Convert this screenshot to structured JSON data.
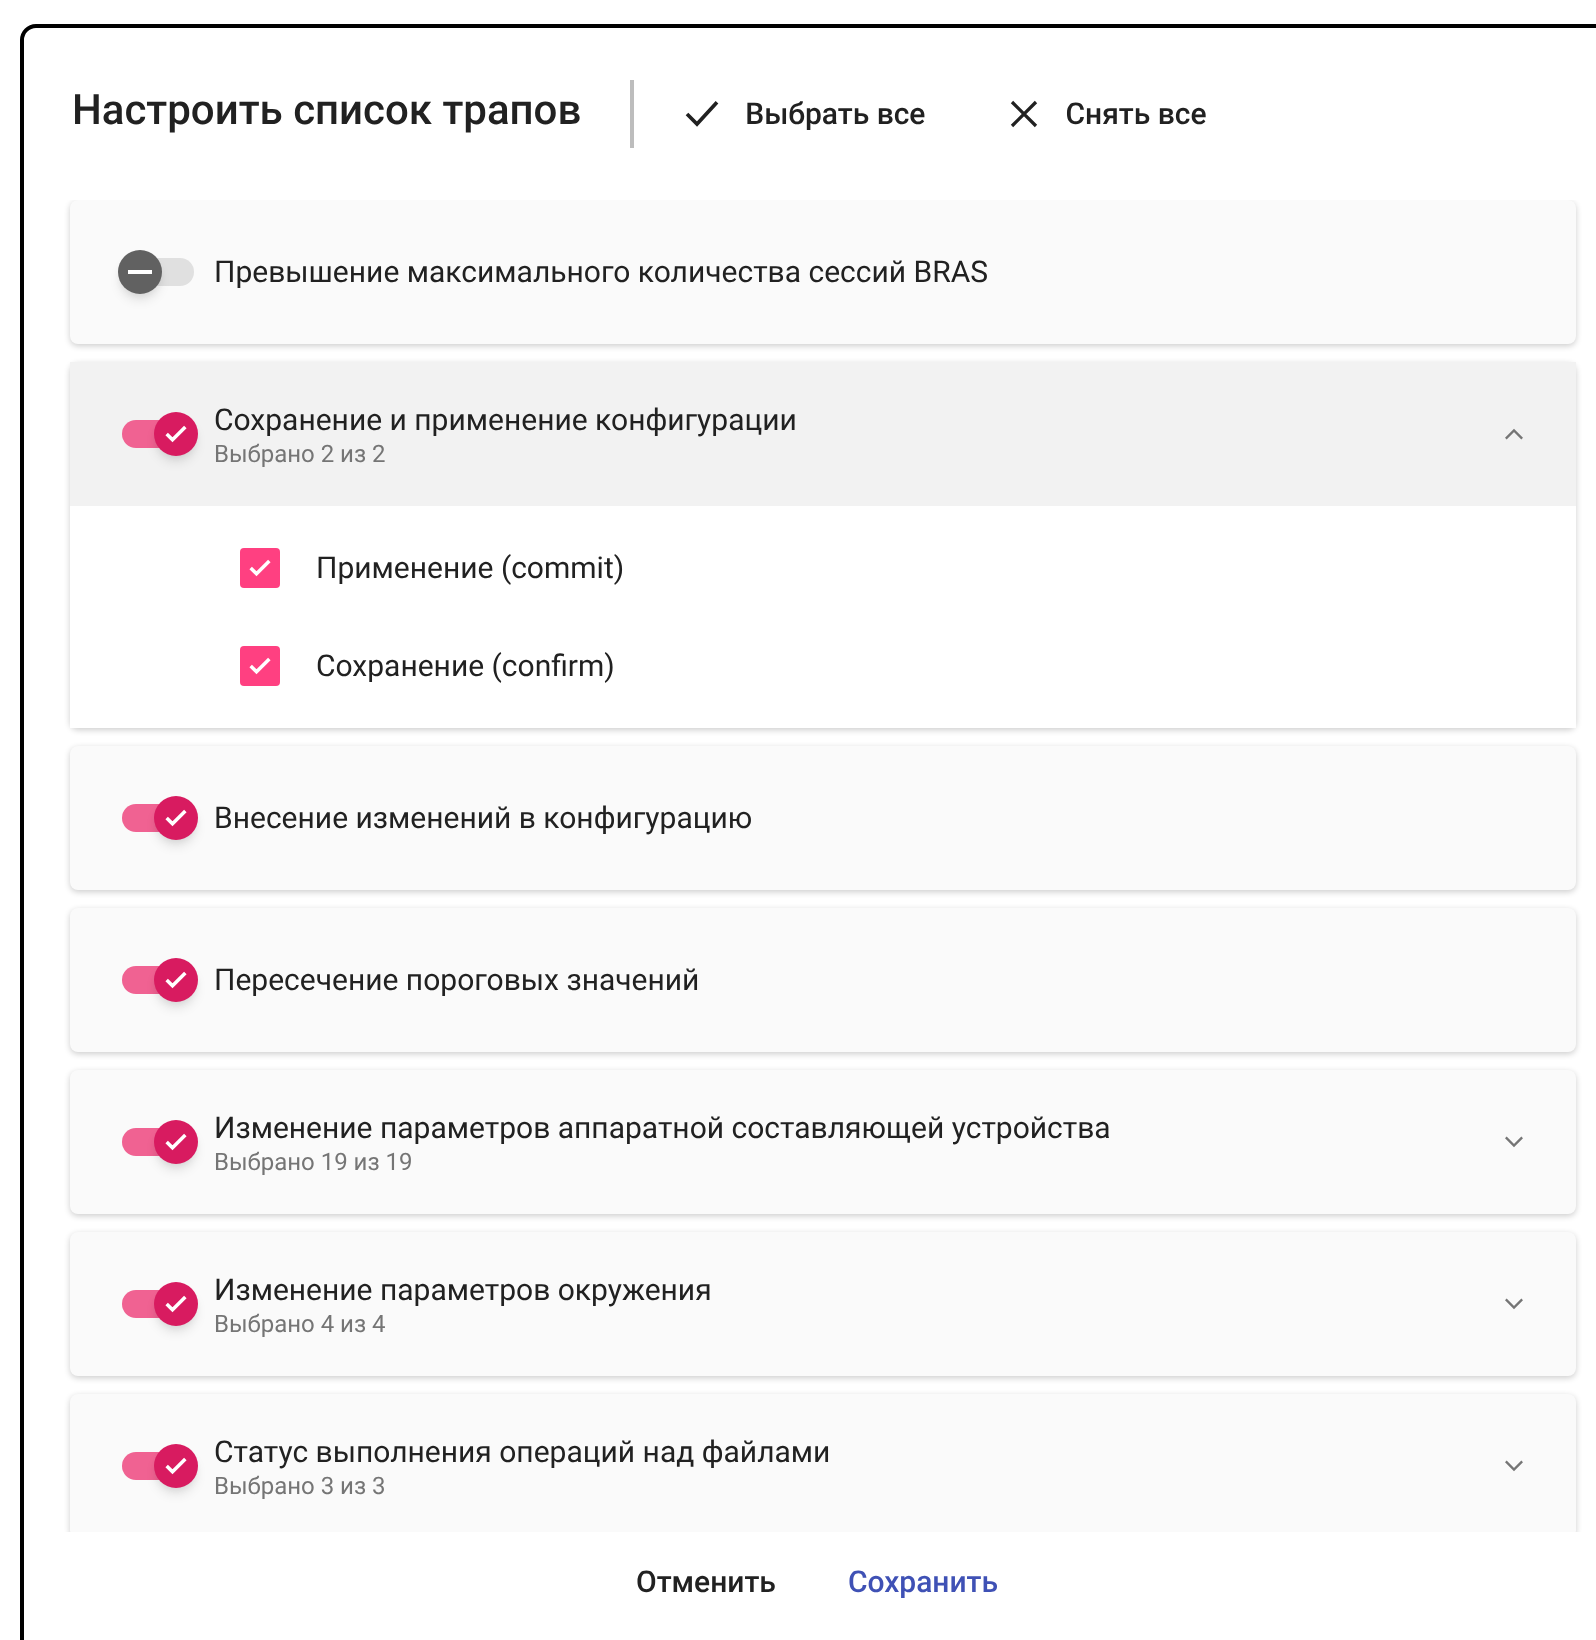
{
  "dialog": {
    "title": "Настроить список трапов",
    "actions": [
      "Выбрать все",
      "Снять все"
    ]
  },
  "groups": [
    {
      "label": "Превышение максимального количества сессий BRAS",
      "on": false,
      "indeterminate": true
    },
    {
      "label": "Сохранение и применение конфигурации",
      "on": true,
      "summary": "Выбрано 2 из 2",
      "expanded": true,
      "children": [
        {
          "label": "Применение (commit)",
          "checked": true
        },
        {
          "label": "Сохранение (confirm)",
          "checked": true
        }
      ]
    },
    {
      "label": "Внесение изменений в конфигурацию",
      "on": true
    },
    {
      "label": "Пересечение пороговых значений",
      "on": true
    },
    {
      "label": "Изменение параметров аппаратной составляющей устройства",
      "on": true,
      "summary": "Выбрано 19 из 19",
      "expanded": false
    },
    {
      "label": "Изменение параметров окружения",
      "on": true,
      "summary": "Выбрано 4 из 4",
      "expanded": false
    },
    {
      "label": "Статус выполнения операций над файлами",
      "on": true,
      "summary": "Выбрано 3 из 3",
      "expanded": false
    }
  ],
  "footer": {
    "cancel": "Отменить",
    "save": "Сохранить"
  }
}
